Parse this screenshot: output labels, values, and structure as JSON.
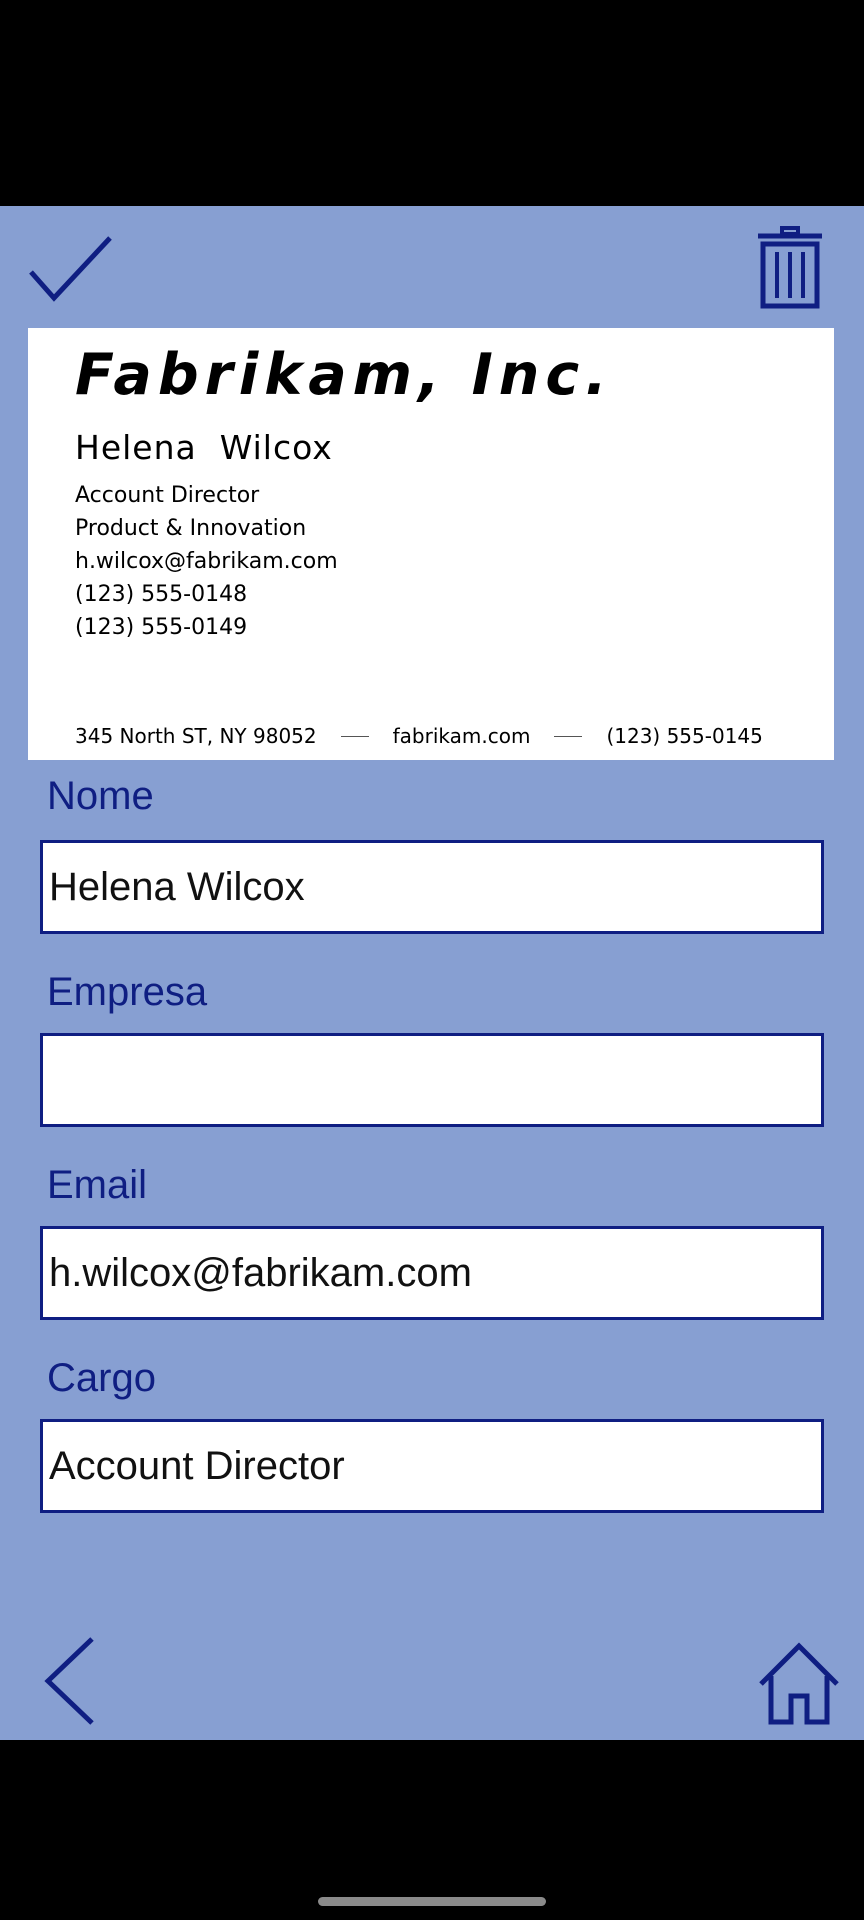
{
  "business_card": {
    "company": "Fabrikam, Inc.",
    "name": "Helena  Wilcox",
    "lines": [
      "Account Director",
      "Product & Innovation",
      "h.wilcox@fabrikam.com",
      "(123) 555-0148",
      "(123) 555-0149"
    ],
    "footer": {
      "address": "345 North ST, NY 98052",
      "website": "fabrikam.com",
      "phone": "(123) 555-0145"
    }
  },
  "form": {
    "name": {
      "label": "Nome",
      "value": "Helena Wilcox"
    },
    "company": {
      "label": "Empresa",
      "value": ""
    },
    "email": {
      "label": "Email",
      "value": "h.wilcox@fabrikam.com"
    },
    "title": {
      "label": "Cargo",
      "value": "Account Director"
    }
  },
  "icons": {
    "confirm": "check-icon",
    "delete": "trash-icon",
    "back": "chevron-left-icon",
    "home": "home-icon"
  },
  "colors": {
    "app_background": "#879FD2",
    "accent": "#0F1E82",
    "card_background": "#FFFFFF"
  }
}
